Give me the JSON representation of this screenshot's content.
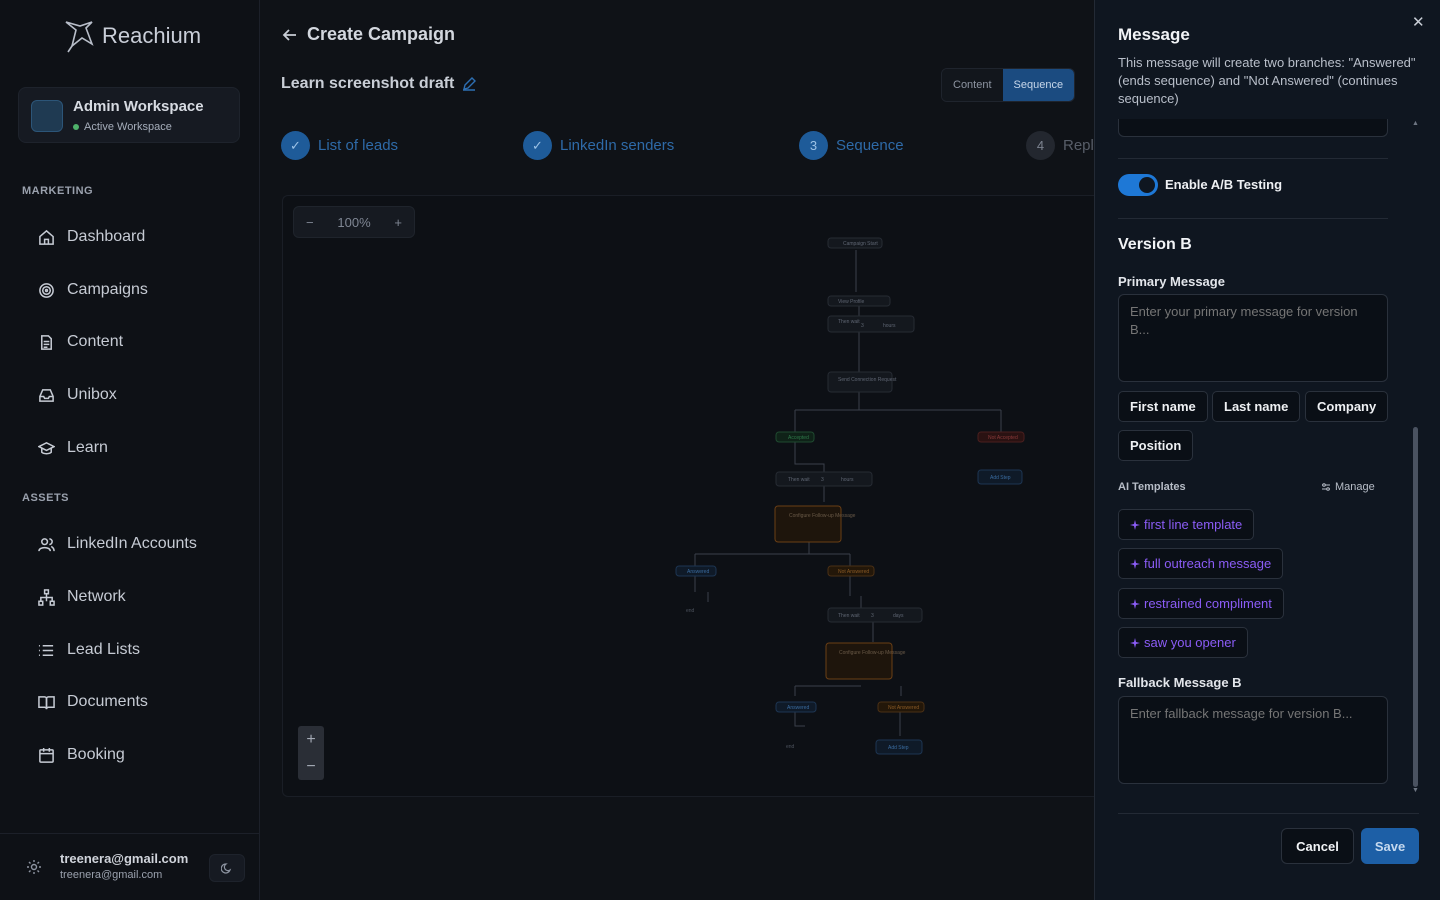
{
  "brand": {
    "name": "Reachium"
  },
  "workspace": {
    "name": "Admin Workspace",
    "status": "Active Workspace"
  },
  "sidebar": {
    "marketing_label": "MARKETING",
    "marketing": [
      {
        "label": "Dashboard",
        "icon": "home-icon"
      },
      {
        "label": "Campaigns",
        "icon": "target-icon"
      },
      {
        "label": "Content",
        "icon": "document-icon"
      },
      {
        "label": "Unibox",
        "icon": "inbox-icon"
      },
      {
        "label": "Learn",
        "icon": "graduation-cap-icon"
      }
    ],
    "assets_label": "ASSETS",
    "assets": [
      {
        "label": "LinkedIn Accounts",
        "icon": "users-icon"
      },
      {
        "label": "Network",
        "icon": "network-icon"
      },
      {
        "label": "Lead Lists",
        "icon": "list-icon"
      },
      {
        "label": "Documents",
        "icon": "book-icon"
      },
      {
        "label": "Booking",
        "icon": "calendar-icon"
      }
    ],
    "user": {
      "email": "treenera@gmail.com",
      "sub_email": "treenera@gmail.com"
    }
  },
  "main": {
    "title": "Create Campaign",
    "draft_name": "Learn screenshot draft",
    "view_tabs": [
      {
        "label": "Content",
        "active": false
      },
      {
        "label": "Sequence",
        "active": true
      }
    ],
    "steps": [
      {
        "label": "List of leads",
        "marker": "✓",
        "state": "done"
      },
      {
        "label": "LinkedIn senders",
        "marker": "✓",
        "state": "done"
      },
      {
        "label": "Sequence",
        "marker": "3",
        "state": "current"
      },
      {
        "label": "Reply",
        "marker": "4",
        "state": "upcoming"
      }
    ],
    "canvas": {
      "zoom": "100%",
      "nodes": {
        "start": "Campaign Start",
        "view_profile": "View Profile",
        "then_wait": "Then wait",
        "wait1_value": "3",
        "wait1_unit": "hours",
        "send_request": "Send Connection Request",
        "accepted": "Accepted",
        "not_accepted": "Not Accepted",
        "add_step": "Add Step",
        "wait2_value": "3",
        "wait2_unit": "hours",
        "followup": "Configure Follow-up Message",
        "answered": "Answered",
        "not_answered": "Not Answered",
        "end": "end",
        "wait3_value": "3",
        "wait3_unit": "days"
      }
    }
  },
  "panel": {
    "title": "Message",
    "close": "✕",
    "description": "This message will create two branches: \"Answered\" (ends sequence) and \"Not Answered\" (continues sequence)",
    "ab_toggle": {
      "label": "Enable A/B Testing",
      "on": true
    },
    "version_title": "Version B",
    "primary_label": "Primary Message",
    "primary_placeholder": "Enter your primary message for version B...",
    "variables": [
      "First name",
      "Last name",
      "Company",
      "Position"
    ],
    "ai_label": "AI Templates",
    "manage_label": "Manage",
    "templates": [
      "first line template",
      "full outreach message",
      "restrained compliment",
      "saw you opener"
    ],
    "fallback_label": "Fallback Message B",
    "fallback_placeholder": "Enter fallback message for version B...",
    "cancel": "Cancel",
    "save": "Save"
  },
  "colors": {
    "accent": "#1e78d6",
    "template_purple": "#8b5cf6",
    "step_blue": "#1e5b99",
    "accepted_green": "#2f9e5b",
    "rejected_red": "#c0392b",
    "warning_orange": "#c9772a"
  }
}
